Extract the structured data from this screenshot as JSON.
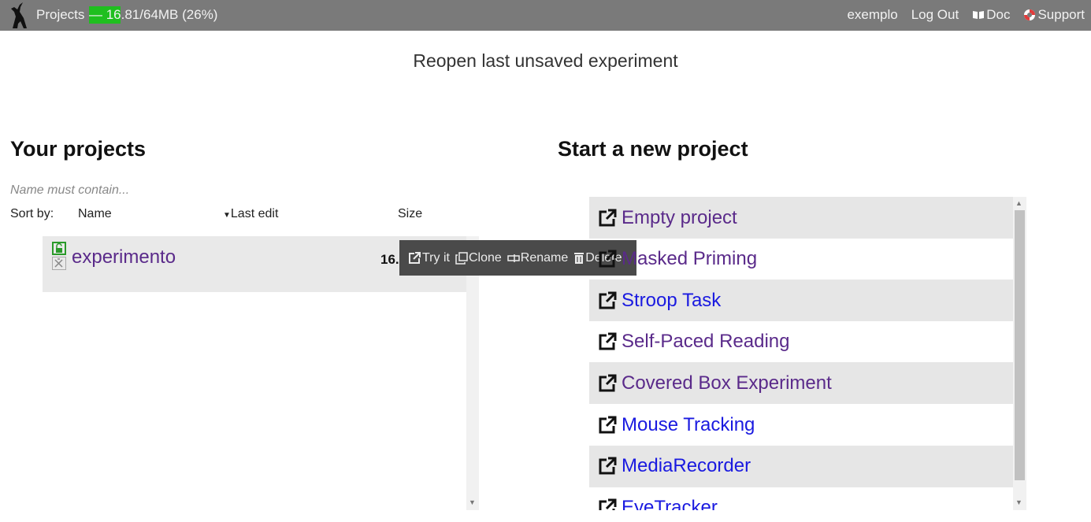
{
  "topbar": {
    "projects_label": "Projects",
    "quota_text": "— 16.81/64MB (26%)",
    "quota_fraction": 0.26,
    "user": "exemplo",
    "logout": "Log Out",
    "doc": "Doc",
    "support": "Support"
  },
  "reopen": "Reopen last unsaved experiment",
  "your_projects": {
    "title": "Your projects",
    "filter_placeholder": "Name must contain...",
    "sort_label": "Sort by:",
    "sort_name": "Name",
    "sort_last_edit": "Last edit",
    "sort_size": "Size",
    "projects": [
      {
        "name": "experimento",
        "size": "16.8"
      }
    ]
  },
  "actions": {
    "try": "Try it",
    "clone": "Clone",
    "rename": "Rename",
    "delete": "Delete"
  },
  "new_project": {
    "title": "Start a new project",
    "templates": [
      {
        "label": "Empty project",
        "visited": true
      },
      {
        "label": "Masked Priming",
        "visited": true
      },
      {
        "label": "Stroop Task",
        "visited": false
      },
      {
        "label": "Self-Paced Reading",
        "visited": true
      },
      {
        "label": "Covered Box Experiment",
        "visited": true
      },
      {
        "label": "Mouse Tracking",
        "visited": false
      },
      {
        "label": "MediaRecorder",
        "visited": false
      },
      {
        "label": "EyeTracker",
        "visited": false
      }
    ]
  },
  "colors": {
    "visited_link": "#5a2a8a",
    "link": "#1a1ae0",
    "quota_fill": "#1fbf1f"
  }
}
